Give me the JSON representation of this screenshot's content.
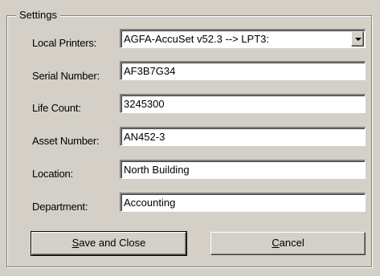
{
  "group": {
    "title": "Settings"
  },
  "fields": {
    "local_printers": {
      "label": "Local Printers:",
      "value": "AGFA-AccuSet v52.3 --> LPT3:"
    },
    "serial_number": {
      "label": "Serial Number:",
      "value": "AF3B7G34"
    },
    "life_count": {
      "label": "Life Count:",
      "value": "3245300"
    },
    "asset_number": {
      "label": "Asset Number:",
      "value": "AN452-3"
    },
    "location": {
      "label": "Location:",
      "value": "North Building"
    },
    "department": {
      "label": "Department:",
      "value": "Accounting"
    }
  },
  "buttons": {
    "save_close": {
      "mnemonic": "S",
      "rest": "ave and Close"
    },
    "cancel": {
      "mnemonic": "C",
      "rest": "ancel"
    }
  },
  "icons": {
    "dropdown": "chevron-down-icon"
  }
}
